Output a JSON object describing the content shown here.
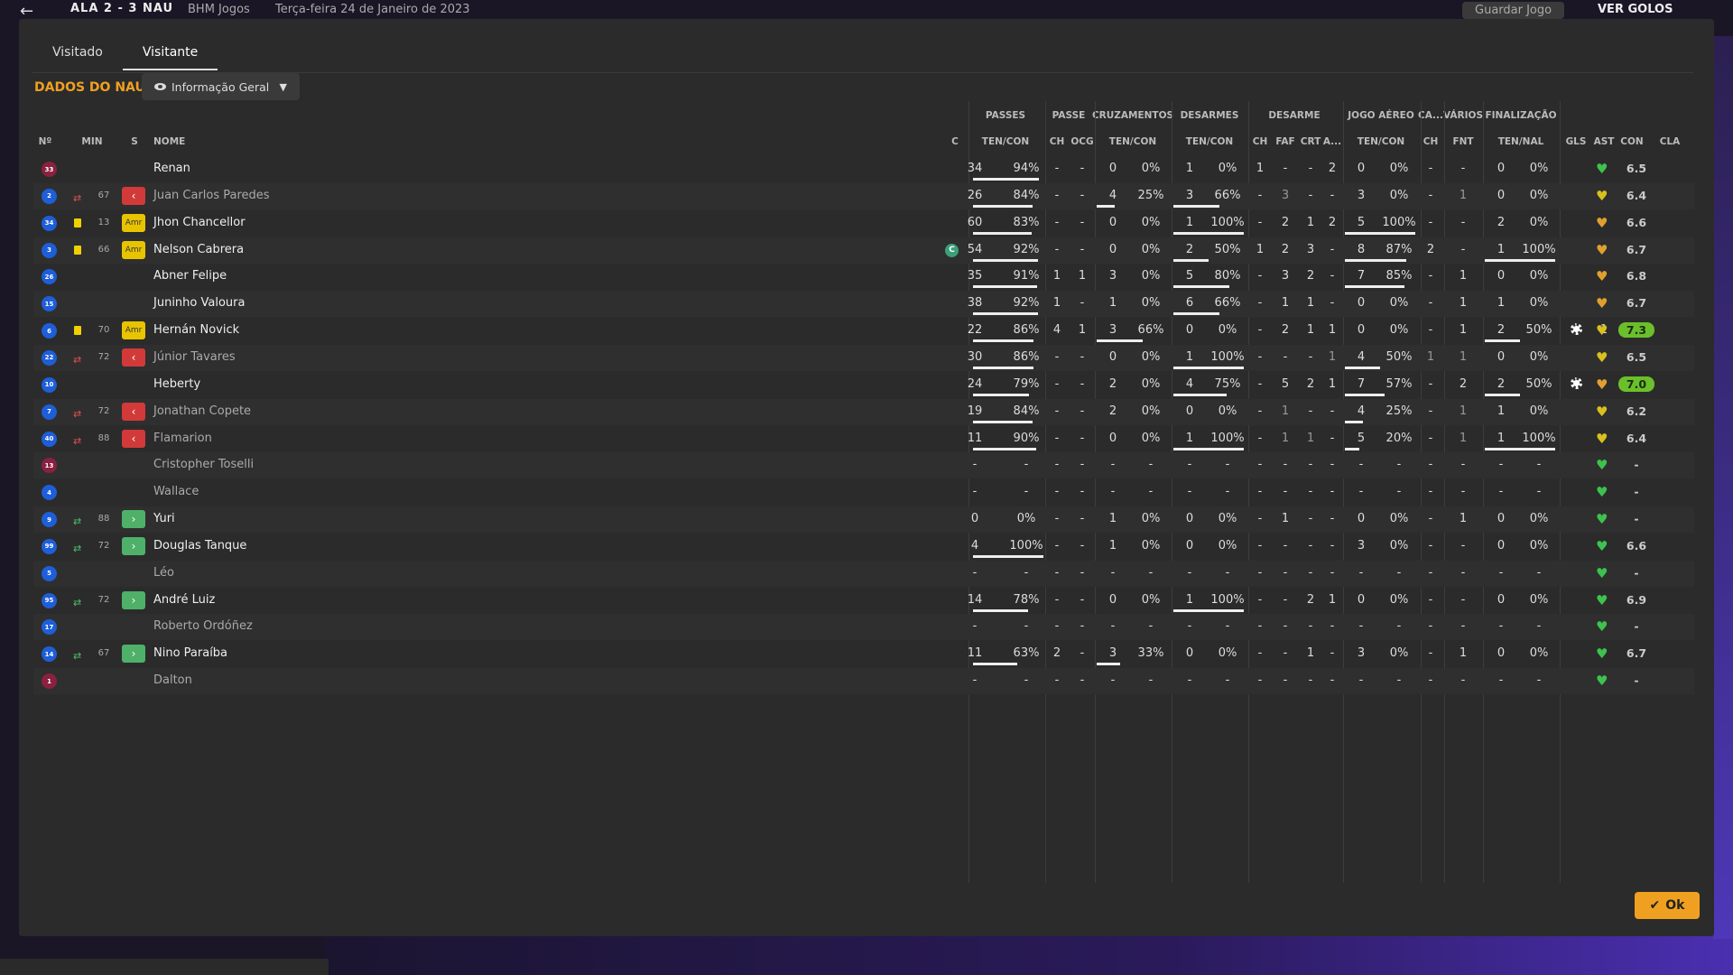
{
  "topbar": {
    "back_icon": "arrow-left-icon",
    "score": "ALA  2 - 3  NAU",
    "competition": "BHM Jogos",
    "date": "Terça-feira 24 de Janeiro de 2023",
    "save_label": "Guardar Jogo",
    "goals_label": "VER GOLOS"
  },
  "tabs": [
    {
      "label": "Visitado",
      "active": false
    },
    {
      "label": "Visitante",
      "active": true
    }
  ],
  "title": "DADOS DO NAU",
  "view_dropdown": {
    "label": "Informação Geral"
  },
  "column_groups": [
    {
      "label": "PASSES"
    },
    {
      "label": "PASSE"
    },
    {
      "label": "CRUZAMENTOS"
    },
    {
      "label": "DESARMES"
    },
    {
      "label": "DESARME"
    },
    {
      "label": "JOGO AÉREO"
    },
    {
      "label": "CA..."
    },
    {
      "label": "VÁRIOS"
    },
    {
      "label": "FINALIZAÇÃO"
    }
  ],
  "columns": {
    "num": "Nº",
    "min": "MIN",
    "s": "S",
    "name": "NOME",
    "c": "C",
    "passes": "TEN/CON",
    "pch": "CH",
    "pocg": "OCG",
    "cross": "TEN/CON",
    "tack": "TEN/CON",
    "dch": "CH",
    "dfaf": "FAF",
    "dcrt": "CRT",
    "da": "A...",
    "aerial": "TEN/CON",
    "cach": "CH",
    "fnt": "FNT",
    "fin": "TEN/NAL",
    "gls": "GLS",
    "ast": "AST",
    "con": "CON",
    "cla": "CLA"
  },
  "players": [
    {
      "num": "33",
      "gk": true,
      "event": "",
      "min": "",
      "s": "",
      "name": "Renan",
      "sub": false,
      "cap": false,
      "pt": "34",
      "pp": "94%",
      "pb": 0.94,
      "pch": "-",
      "pocg": "-",
      "ct": "0",
      "cp": "0%",
      "cb": 0,
      "tt": "1",
      "tp": "0%",
      "tb": 0,
      "dch": "1",
      "dfaf": "-",
      "dcrt": "-",
      "da": "2",
      "at": "0",
      "ap": "0%",
      "ab": 0,
      "cach": "-",
      "fnt": "-",
      "ft": "0",
      "fp": "0%",
      "fb": 0,
      "gls": "",
      "ast": "-",
      "heart": "green",
      "cla": "6.5",
      "hi": false
    },
    {
      "num": "2",
      "gk": false,
      "event": "subout",
      "min": "67",
      "s": "out",
      "name": "Juan Carlos Paredes",
      "sub": true,
      "cap": false,
      "pt": "26",
      "pp": "84%",
      "pb": 0.84,
      "pch": "-",
      "pocg": "-",
      "ct": "4",
      "cp": "25%",
      "cb": 0.25,
      "tt": "3",
      "tp": "66%",
      "tb": 0.66,
      "dch": "-",
      "dfaf": "3",
      "dcrt": "-",
      "da": "-",
      "at": "3",
      "ap": "0%",
      "ab": 0,
      "cach": "-",
      "fnt": "1",
      "ft": "0",
      "fp": "0%",
      "fb": 0,
      "gls": "",
      "ast": "-",
      "heart": "yellow",
      "cla": "6.4",
      "hi": false
    },
    {
      "num": "34",
      "gk": false,
      "event": "yellow",
      "min": "13",
      "s": "amr",
      "name": "Jhon Chancellor",
      "sub": false,
      "cap": false,
      "pt": "60",
      "pp": "83%",
      "pb": 0.83,
      "pch": "-",
      "pocg": "-",
      "ct": "0",
      "cp": "0%",
      "cb": 0,
      "tt": "1",
      "tp": "100%",
      "tb": 1,
      "dch": "-",
      "dfaf": "2",
      "dcrt": "1",
      "da": "2",
      "at": "5",
      "ap": "100%",
      "ab": 1,
      "cach": "-",
      "fnt": "-",
      "ft": "2",
      "fp": "0%",
      "fb": 0,
      "gls": "",
      "ast": "-",
      "heart": "orange",
      "cla": "6.6",
      "hi": false
    },
    {
      "num": "3",
      "gk": false,
      "event": "yellow",
      "min": "66",
      "s": "amr",
      "name": "Nelson Cabrera",
      "sub": false,
      "cap": true,
      "pt": "54",
      "pp": "92%",
      "pb": 0.92,
      "pch": "-",
      "pocg": "-",
      "ct": "0",
      "cp": "0%",
      "cb": 0,
      "tt": "2",
      "tp": "50%",
      "tb": 0.5,
      "dch": "1",
      "dfaf": "2",
      "dcrt": "3",
      "da": "-",
      "at": "8",
      "ap": "87%",
      "ab": 0.87,
      "cach": "2",
      "fnt": "-",
      "ft": "1",
      "fp": "100%",
      "fb": 1,
      "gls": "",
      "ast": "-",
      "heart": "orange",
      "cla": "6.7",
      "hi": false
    },
    {
      "num": "26",
      "gk": false,
      "event": "",
      "min": "",
      "s": "",
      "name": "Abner Felipe",
      "sub": false,
      "cap": false,
      "pt": "35",
      "pp": "91%",
      "pb": 0.91,
      "pch": "1",
      "pocg": "1",
      "ct": "3",
      "cp": "0%",
      "cb": 0,
      "tt": "5",
      "tp": "80%",
      "tb": 0.8,
      "dch": "-",
      "dfaf": "3",
      "dcrt": "2",
      "da": "-",
      "at": "7",
      "ap": "85%",
      "ab": 0.85,
      "cach": "-",
      "fnt": "1",
      "ft": "0",
      "fp": "0%",
      "fb": 0,
      "gls": "",
      "ast": "-",
      "heart": "orange",
      "cla": "6.8",
      "hi": false
    },
    {
      "num": "15",
      "gk": false,
      "event": "",
      "min": "",
      "s": "",
      "name": "Juninho Valoura",
      "sub": false,
      "cap": false,
      "pt": "38",
      "pp": "92%",
      "pb": 0.92,
      "pch": "1",
      "pocg": "-",
      "ct": "1",
      "cp": "0%",
      "cb": 0,
      "tt": "6",
      "tp": "66%",
      "tb": 0.66,
      "dch": "-",
      "dfaf": "1",
      "dcrt": "1",
      "da": "-",
      "at": "0",
      "ap": "0%",
      "ab": 0,
      "cach": "-",
      "fnt": "1",
      "ft": "1",
      "fp": "0%",
      "fb": 0,
      "gls": "",
      "ast": "-",
      "heart": "orange",
      "cla": "6.7",
      "hi": false
    },
    {
      "num": "6",
      "gk": false,
      "event": "yellow",
      "min": "70",
      "s": "amr",
      "name": "Hernán Novick",
      "sub": false,
      "cap": false,
      "pt": "22",
      "pp": "86%",
      "pb": 0.86,
      "pch": "4",
      "pocg": "1",
      "ct": "3",
      "cp": "66%",
      "cb": 0.66,
      "tt": "0",
      "tp": "0%",
      "tb": 0,
      "dch": "-",
      "dfaf": "2",
      "dcrt": "1",
      "da": "1",
      "at": "0",
      "ap": "0%",
      "ab": 0,
      "cach": "-",
      "fnt": "1",
      "ft": "2",
      "fp": "50%",
      "fb": 0.5,
      "gls": "ball",
      "ast": "1",
      "heart": "yellow",
      "cla": "7.3",
      "hi": true
    },
    {
      "num": "22",
      "gk": false,
      "event": "subout",
      "min": "72",
      "s": "out",
      "name": "Júnior Tavares",
      "sub": true,
      "cap": false,
      "pt": "30",
      "pp": "86%",
      "pb": 0.86,
      "pch": "-",
      "pocg": "-",
      "ct": "0",
      "cp": "0%",
      "cb": 0,
      "tt": "1",
      "tp": "100%",
      "tb": 1,
      "dch": "-",
      "dfaf": "-",
      "dcrt": "-",
      "da": "1",
      "at": "4",
      "ap": "50%",
      "ab": 0.5,
      "cach": "1",
      "fnt": "1",
      "ft": "0",
      "fp": "0%",
      "fb": 0,
      "gls": "",
      "ast": "-",
      "heart": "yellow",
      "cla": "6.5",
      "hi": false
    },
    {
      "num": "10",
      "gk": false,
      "event": "",
      "min": "",
      "s": "",
      "name": "Heberty",
      "sub": false,
      "cap": false,
      "pt": "24",
      "pp": "79%",
      "pb": 0.79,
      "pch": "-",
      "pocg": "-",
      "ct": "2",
      "cp": "0%",
      "cb": 0,
      "tt": "4",
      "tp": "75%",
      "tb": 0.75,
      "dch": "-",
      "dfaf": "5",
      "dcrt": "2",
      "da": "1",
      "at": "7",
      "ap": "57%",
      "ab": 0.57,
      "cach": "-",
      "fnt": "2",
      "ft": "2",
      "fp": "50%",
      "fb": 0.5,
      "gls": "ball",
      "ast": "-",
      "heart": "orange",
      "cla": "7.0",
      "hi": true
    },
    {
      "num": "7",
      "gk": false,
      "event": "subout",
      "min": "72",
      "s": "out",
      "name": "Jonathan Copete",
      "sub": true,
      "cap": false,
      "pt": "19",
      "pp": "84%",
      "pb": 0.84,
      "pch": "-",
      "pocg": "-",
      "ct": "2",
      "cp": "0%",
      "cb": 0,
      "tt": "0",
      "tp": "0%",
      "tb": 0,
      "dch": "-",
      "dfaf": "1",
      "dcrt": "-",
      "da": "-",
      "at": "4",
      "ap": "25%",
      "ab": 0.25,
      "cach": "-",
      "fnt": "1",
      "ft": "1",
      "fp": "0%",
      "fb": 0,
      "gls": "",
      "ast": "-",
      "heart": "yellow",
      "cla": "6.2",
      "hi": false
    },
    {
      "num": "40",
      "gk": false,
      "event": "subout",
      "min": "88",
      "s": "out",
      "name": "Flamarion",
      "sub": true,
      "cap": false,
      "pt": "11",
      "pp": "90%",
      "pb": 0.9,
      "pch": "-",
      "pocg": "-",
      "ct": "0",
      "cp": "0%",
      "cb": 0,
      "tt": "1",
      "tp": "100%",
      "tb": 1,
      "dch": "-",
      "dfaf": "1",
      "dcrt": "1",
      "da": "-",
      "at": "5",
      "ap": "20%",
      "ab": 0.2,
      "cach": "-",
      "fnt": "1",
      "ft": "1",
      "fp": "100%",
      "fb": 1,
      "gls": "",
      "ast": "-",
      "heart": "yellow",
      "cla": "6.4",
      "hi": false
    },
    {
      "num": "13",
      "gk": true,
      "event": "",
      "min": "",
      "s": "",
      "name": "Cristopher Toselli",
      "sub": true,
      "cap": false,
      "pt": "-",
      "pp": "-",
      "pb": 0,
      "pch": "-",
      "pocg": "-",
      "ct": "-",
      "cp": "-",
      "cb": 0,
      "tt": "-",
      "tp": "-",
      "tb": 0,
      "dch": "-",
      "dfaf": "-",
      "dcrt": "-",
      "da": "-",
      "at": "-",
      "ap": "-",
      "ab": 0,
      "cach": "-",
      "fnt": "-",
      "ft": "-",
      "fp": "-",
      "fb": 0,
      "gls": "",
      "ast": "-",
      "heart": "green",
      "cla": "-",
      "hi": false
    },
    {
      "num": "4",
      "gk": false,
      "event": "",
      "min": "",
      "s": "",
      "name": "Wallace",
      "sub": true,
      "cap": false,
      "pt": "-",
      "pp": "-",
      "pb": 0,
      "pch": "-",
      "pocg": "-",
      "ct": "-",
      "cp": "-",
      "cb": 0,
      "tt": "-",
      "tp": "-",
      "tb": 0,
      "dch": "-",
      "dfaf": "-",
      "dcrt": "-",
      "da": "-",
      "at": "-",
      "ap": "-",
      "ab": 0,
      "cach": "-",
      "fnt": "-",
      "ft": "-",
      "fp": "-",
      "fb": 0,
      "gls": "",
      "ast": "-",
      "heart": "green",
      "cla": "-",
      "hi": false
    },
    {
      "num": "9",
      "gk": false,
      "event": "subin",
      "min": "88",
      "s": "in",
      "name": "Yuri",
      "sub": false,
      "cap": false,
      "pt": "0",
      "pp": "0%",
      "pb": 0,
      "pch": "-",
      "pocg": "-",
      "ct": "1",
      "cp": "0%",
      "cb": 0,
      "tt": "0",
      "tp": "0%",
      "tb": 0,
      "dch": "-",
      "dfaf": "1",
      "dcrt": "-",
      "da": "-",
      "at": "0",
      "ap": "0%",
      "ab": 0,
      "cach": "-",
      "fnt": "1",
      "ft": "0",
      "fp": "0%",
      "fb": 0,
      "gls": "",
      "ast": "-",
      "heart": "green",
      "cla": "-",
      "hi": false
    },
    {
      "num": "99",
      "gk": false,
      "event": "subin",
      "min": "72",
      "s": "in",
      "name": "Douglas Tanque",
      "sub": false,
      "cap": false,
      "pt": "4",
      "pp": "100%",
      "pb": 1,
      "pch": "-",
      "pocg": "-",
      "ct": "1",
      "cp": "0%",
      "cb": 0,
      "tt": "0",
      "tp": "0%",
      "tb": 0,
      "dch": "-",
      "dfaf": "-",
      "dcrt": "-",
      "da": "-",
      "at": "3",
      "ap": "0%",
      "ab": 0,
      "cach": "-",
      "fnt": "-",
      "ft": "0",
      "fp": "0%",
      "fb": 0,
      "gls": "",
      "ast": "-",
      "heart": "green",
      "cla": "6.6",
      "hi": false
    },
    {
      "num": "5",
      "gk": false,
      "event": "",
      "min": "",
      "s": "",
      "name": "Léo",
      "sub": true,
      "cap": false,
      "pt": "-",
      "pp": "-",
      "pb": 0,
      "pch": "-",
      "pocg": "-",
      "ct": "-",
      "cp": "-",
      "cb": 0,
      "tt": "-",
      "tp": "-",
      "tb": 0,
      "dch": "-",
      "dfaf": "-",
      "dcrt": "-",
      "da": "-",
      "at": "-",
      "ap": "-",
      "ab": 0,
      "cach": "-",
      "fnt": "-",
      "ft": "-",
      "fp": "-",
      "fb": 0,
      "gls": "",
      "ast": "-",
      "heart": "green",
      "cla": "-",
      "hi": false
    },
    {
      "num": "95",
      "gk": false,
      "event": "subin",
      "min": "72",
      "s": "in",
      "name": "André Luiz",
      "sub": false,
      "cap": false,
      "pt": "14",
      "pp": "78%",
      "pb": 0.78,
      "pch": "-",
      "pocg": "-",
      "ct": "0",
      "cp": "0%",
      "cb": 0,
      "tt": "1",
      "tp": "100%",
      "tb": 1,
      "dch": "-",
      "dfaf": "-",
      "dcrt": "2",
      "da": "1",
      "at": "0",
      "ap": "0%",
      "ab": 0,
      "cach": "-",
      "fnt": "-",
      "ft": "0",
      "fp": "0%",
      "fb": 0,
      "gls": "",
      "ast": "-",
      "heart": "green",
      "cla": "6.9",
      "hi": false
    },
    {
      "num": "17",
      "gk": false,
      "event": "",
      "min": "",
      "s": "",
      "name": "Roberto Ordóñez",
      "sub": true,
      "cap": false,
      "pt": "-",
      "pp": "-",
      "pb": 0,
      "pch": "-",
      "pocg": "-",
      "ct": "-",
      "cp": "-",
      "cb": 0,
      "tt": "-",
      "tp": "-",
      "tb": 0,
      "dch": "-",
      "dfaf": "-",
      "dcrt": "-",
      "da": "-",
      "at": "-",
      "ap": "-",
      "ab": 0,
      "cach": "-",
      "fnt": "-",
      "ft": "-",
      "fp": "-",
      "fb": 0,
      "gls": "",
      "ast": "-",
      "heart": "green",
      "cla": "-",
      "hi": false
    },
    {
      "num": "14",
      "gk": false,
      "event": "subin",
      "min": "67",
      "s": "in",
      "name": "Nino Paraíba",
      "sub": false,
      "cap": false,
      "pt": "11",
      "pp": "63%",
      "pb": 0.63,
      "pch": "2",
      "pocg": "-",
      "ct": "3",
      "cp": "33%",
      "cb": 0.33,
      "tt": "0",
      "tp": "0%",
      "tb": 0,
      "dch": "-",
      "dfaf": "-",
      "dcrt": "1",
      "da": "-",
      "at": "3",
      "ap": "0%",
      "ab": 0,
      "cach": "-",
      "fnt": "1",
      "ft": "0",
      "fp": "0%",
      "fb": 0,
      "gls": "",
      "ast": "-",
      "heart": "green",
      "cla": "6.7",
      "hi": false
    },
    {
      "num": "1",
      "gk": true,
      "event": "",
      "min": "",
      "s": "",
      "name": "Dalton",
      "sub": true,
      "cap": false,
      "pt": "-",
      "pp": "-",
      "pb": 0,
      "pch": "-",
      "pocg": "-",
      "ct": "-",
      "cp": "-",
      "cb": 0,
      "tt": "-",
      "tp": "-",
      "tb": 0,
      "dch": "-",
      "dfaf": "-",
      "dcrt": "-",
      "da": "-",
      "at": "-",
      "ap": "-",
      "ab": 0,
      "cach": "-",
      "fnt": "-",
      "ft": "-",
      "fp": "-",
      "fb": 0,
      "gls": "",
      "ast": "-",
      "heart": "green",
      "cla": "-",
      "hi": false
    }
  ],
  "captain_marker": "C",
  "yellow_badge_label": "Amr",
  "colors": {
    "accent": "#f0a020",
    "heart_green": "#3ec24e",
    "heart_yellow": "#d8c020",
    "heart_orange": "#e0a030",
    "sub_out": "#d23a3a",
    "sub_in": "#4fb06a",
    "rating_high": "#6abf2a"
  },
  "ok_label": "Ok"
}
